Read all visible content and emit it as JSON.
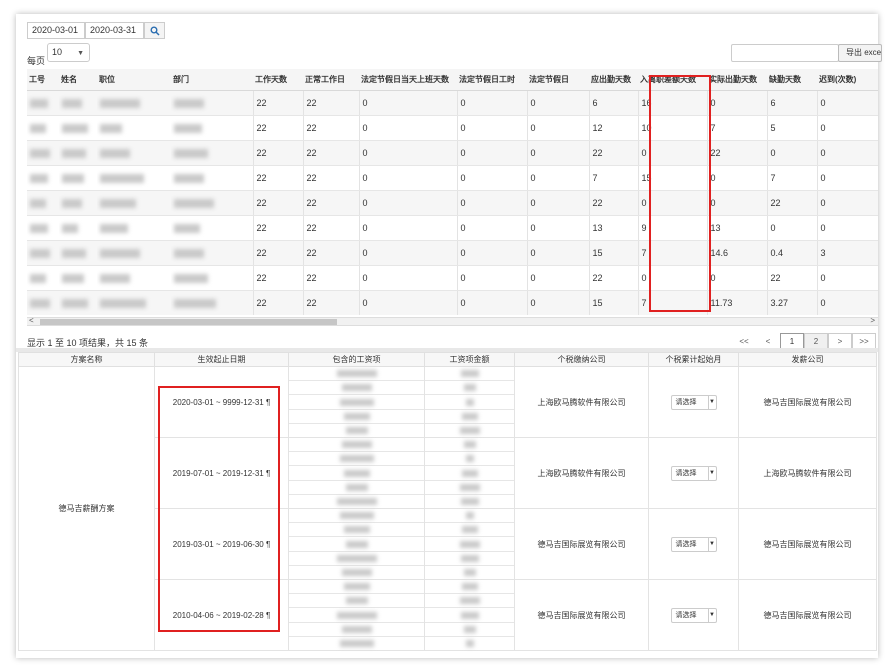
{
  "filters": {
    "start_date": "2020-03-01",
    "end_date": "2020-03-31",
    "per_page_label": "每页",
    "per_page_value": "10",
    "export_label": "导出 excel"
  },
  "main_table": {
    "columns": [
      "工号",
      "姓名",
      "职位",
      "部门",
      "工作天数",
      "正常工作日",
      "法定节假日当天上班天数",
      "法定节假日工时",
      "法定节假日",
      "应出勤天数",
      "入离职差额天数",
      "实际出勤天数",
      "缺勤天数",
      "迟到(次数)"
    ],
    "rows": [
      [
        "22",
        "22",
        "0",
        "0",
        "0",
        "6",
        "16",
        "0",
        "6",
        "0"
      ],
      [
        "22",
        "22",
        "0",
        "0",
        "0",
        "12",
        "10",
        "7",
        "5",
        "0"
      ],
      [
        "22",
        "22",
        "0",
        "0",
        "0",
        "22",
        "0",
        "22",
        "0",
        "0"
      ],
      [
        "22",
        "22",
        "0",
        "0",
        "0",
        "7",
        "15",
        "0",
        "7",
        "0"
      ],
      [
        "22",
        "22",
        "0",
        "0",
        "0",
        "22",
        "0",
        "0",
        "22",
        "0"
      ],
      [
        "22",
        "22",
        "0",
        "0",
        "0",
        "13",
        "9",
        "13",
        "0",
        "0"
      ],
      [
        "22",
        "22",
        "0",
        "0",
        "0",
        "15",
        "7",
        "14.6",
        "0.4",
        "3"
      ],
      [
        "22",
        "22",
        "0",
        "0",
        "0",
        "22",
        "0",
        "0",
        "22",
        "0"
      ],
      [
        "22",
        "22",
        "0",
        "0",
        "0",
        "15",
        "7",
        "11.73",
        "3.27",
        "0"
      ]
    ]
  },
  "pagination": {
    "info": "显示 1 至 10 项结果，共 15 条",
    "first": "<<",
    "prev": "<",
    "page1": "1",
    "page2": "2",
    "next": ">",
    "last": ">>"
  },
  "plan_table": {
    "columns": [
      "方案名称",
      "生效起止日期",
      "包含的工资项",
      "工资项金额",
      "个税缴纳公司",
      "个税累计起始月",
      "发薪公司"
    ],
    "plan_name": "德马吉薪酬方案",
    "select_placeholder": "请选择",
    "rows": [
      {
        "date_range": "2020-03-01 ~ 9999-12-31",
        "tax_company": "上海欧马腾软件有限公司",
        "pay_company": "德马吉国际展览有限公司"
      },
      {
        "date_range": "2019-07-01 ~ 2019-12-31",
        "tax_company": "上海欧马腾软件有限公司",
        "pay_company": "上海欧马腾软件有限公司"
      },
      {
        "date_range": "2019-03-01 ~ 2019-06-30",
        "tax_company": "德马吉国际展览有限公司",
        "pay_company": "德马吉国际展览有限公司"
      },
      {
        "date_range": "2010-04-06 ~ 2019-02-28",
        "tax_company": "德马吉国际展览有限公司",
        "pay_company": "德马吉国际展览有限公司"
      }
    ]
  }
}
